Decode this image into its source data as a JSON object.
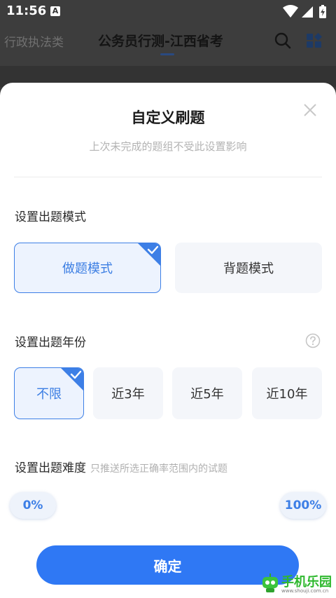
{
  "status_bar": {
    "time": "11:56",
    "notification_letter": "A"
  },
  "header": {
    "left_tab": "行政执法类",
    "title": "公务员行测-江西省考"
  },
  "sheet": {
    "title": "自定义刷题",
    "subtitle": "上次未完成的题组不受此设置影响",
    "mode_section": {
      "label": "设置出题模式",
      "options": [
        {
          "label": "做题模式",
          "selected": true
        },
        {
          "label": "背题模式",
          "selected": false
        }
      ]
    },
    "year_section": {
      "label": "设置出题年份",
      "options": [
        {
          "label": "不限",
          "selected": true
        },
        {
          "label": "近3年",
          "selected": false
        },
        {
          "label": "近5年",
          "selected": false
        },
        {
          "label": "近10年",
          "selected": false
        }
      ]
    },
    "difficulty_section": {
      "label": "设置出题难度",
      "hint": "只推送所选正确率范围内的试题",
      "min_label": "0%",
      "max_label": "100%"
    },
    "confirm_label": "确定"
  },
  "watermark": {
    "text": "手机乐园",
    "sub": "www.shouji.com.cn"
  },
  "colors": {
    "accent": "#2f78f4",
    "selected_bg": "#edf3fe",
    "option_bg": "#f4f6fa"
  }
}
